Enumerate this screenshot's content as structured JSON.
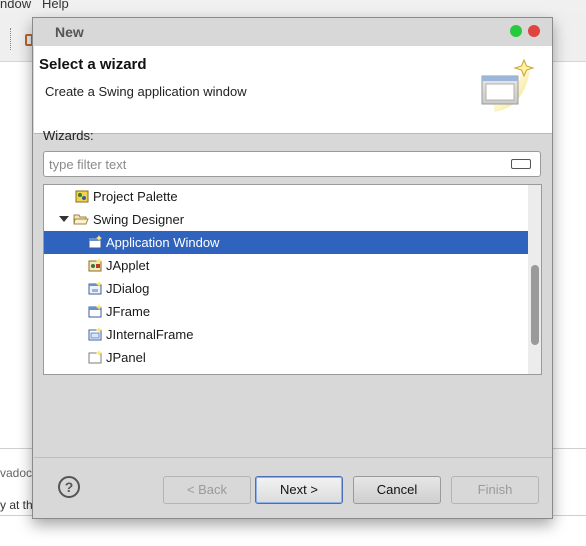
{
  "ide": {
    "menu_left": "ndow",
    "menu_help": "Help",
    "panel_text": "vadoc",
    "panel_text2": "y at th"
  },
  "dialog": {
    "title": "New",
    "window_buttons": {
      "minimize_color": "#27c93f",
      "close_color": "#e0443e"
    }
  },
  "banner": {
    "title": "Select a wizard",
    "description": "Create a Swing application window",
    "icon": "wizard-window-icon"
  },
  "wizards": {
    "label": "Wizards:",
    "filter_placeholder": "type filter text",
    "filter_value": "",
    "items": [
      {
        "label": "Project Palette",
        "icon": "palette-icon",
        "selected": false
      },
      {
        "label": "Swing Designer",
        "icon": "folder-open-icon",
        "expanded": true,
        "selected": false
      },
      {
        "label": "Application Window",
        "icon": "window-icon",
        "selected": true
      },
      {
        "label": "JApplet",
        "icon": "applet-icon",
        "selected": false
      },
      {
        "label": "JDialog",
        "icon": "dialog-icon",
        "selected": false
      },
      {
        "label": "JFrame",
        "icon": "frame-icon",
        "selected": false
      },
      {
        "label": "JInternalFrame",
        "icon": "internal-frame-icon",
        "selected": false
      },
      {
        "label": "JPanel",
        "icon": "panel-icon",
        "selected": false
      }
    ]
  },
  "buttons": {
    "help": "?",
    "back": "< Back",
    "next": "Next >",
    "cancel": "Cancel",
    "finish": "Finish"
  },
  "colors": {
    "selection": "#3063bd",
    "dialog_bg": "#d8d8d8",
    "banner_bg": "#ffffff"
  }
}
